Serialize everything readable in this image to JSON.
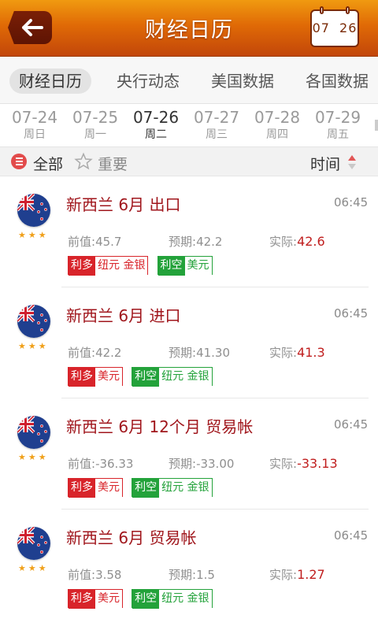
{
  "header": {
    "title": "财经日历",
    "calendar_badge": "07 26",
    "back_icon": "arrow-left-icon",
    "calendar_icon": "calendar-icon"
  },
  "tabs": [
    {
      "label": "财经日历",
      "active": true
    },
    {
      "label": "央行动态",
      "active": false
    },
    {
      "label": "美国数据",
      "active": false
    },
    {
      "label": "各国数据",
      "active": false
    }
  ],
  "dates": [
    {
      "date": "07-24",
      "weekday": "周日",
      "selected": false
    },
    {
      "date": "07-25",
      "weekday": "周一",
      "selected": false
    },
    {
      "date": "07-26",
      "weekday": "周二",
      "selected": true
    },
    {
      "date": "07-27",
      "weekday": "周三",
      "selected": false
    },
    {
      "date": "07-28",
      "weekday": "周四",
      "selected": false
    },
    {
      "date": "07-29",
      "weekday": "周五",
      "selected": false
    }
  ],
  "filter": {
    "all_label": "全部",
    "important_label": "重要",
    "time_label": "时间"
  },
  "labels": {
    "prev": "前值:",
    "forecast": "预期:",
    "actual": "实际:",
    "bullish": "利多",
    "bearish": "利空"
  },
  "events": [
    {
      "title": "新西兰 6月 出口",
      "time": "06:45",
      "stars": "★★★",
      "prev": "45.7",
      "forecast": "42.2",
      "actual": "42.6",
      "bullish": "纽元 金银",
      "bearish": "美元"
    },
    {
      "title": "新西兰 6月 进口",
      "time": "06:45",
      "stars": "★★★",
      "prev": "42.2",
      "forecast": "41.30",
      "actual": "41.3",
      "bullish": "美元",
      "bearish": "纽元 金银"
    },
    {
      "title": "新西兰 6月 12个月 贸易帐",
      "time": "06:45",
      "stars": "★★★",
      "prev": "-36.33",
      "forecast": "-33.00",
      "actual": "-33.13",
      "bullish": "美元",
      "bearish": "纽元 金银"
    },
    {
      "title": "新西兰 6月 贸易帐",
      "time": "06:45",
      "stars": "★★★",
      "prev": "3.58",
      "forecast": "1.5",
      "actual": "1.27",
      "bullish": "美元",
      "bearish": "纽元 金银"
    }
  ],
  "colors": {
    "header_orange": "#e06a06",
    "title_red": "#a0161c",
    "bullish_red": "#d8242a",
    "bearish_green": "#23a23a",
    "star_gold": "#f0a01a"
  }
}
